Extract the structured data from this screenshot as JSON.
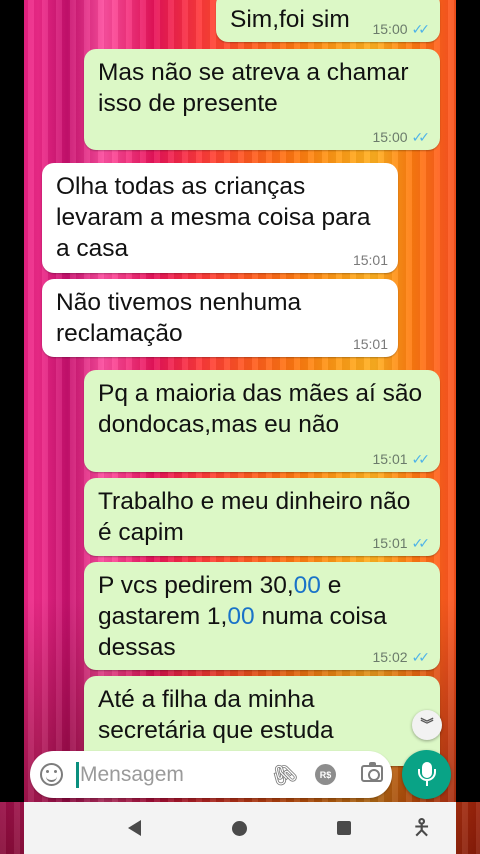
{
  "colors": {
    "outgoing_bubble": "#dcf8c6",
    "incoming_bubble": "#ffffff",
    "read_ticks": "#4fb3e8",
    "mic_button": "#09a386"
  },
  "messages": [
    {
      "direction": "out",
      "text": "Sim,foi sim",
      "time": "15:00",
      "read": true
    },
    {
      "direction": "out",
      "text": "Mas não se atreva a chamar isso de presente",
      "time": "15:00",
      "read": true
    },
    {
      "direction": "in",
      "text": "Olha todas as crianças levaram a mesma coisa para a casa",
      "time": "15:01"
    },
    {
      "direction": "in",
      "text": "Não tivemos nenhuma reclamação",
      "time": "15:01"
    },
    {
      "direction": "out",
      "text": "Pq a maioria das mães aí são dondocas,mas eu não",
      "time": "15:01",
      "read": true
    },
    {
      "direction": "out",
      "text": "Trabalho e meu dinheiro não é capim",
      "time": "15:01",
      "read": true
    },
    {
      "direction": "out",
      "text_parts": [
        "P vcs pedirem 30,",
        "00",
        " e gastarem 1,",
        "00",
        " numa coisa dessas"
      ],
      "time": "15:02",
      "read": true
    },
    {
      "direction": "out",
      "text": "Até a filha da minha secretária que estuda",
      "time": ""
    }
  ],
  "composer": {
    "placeholder": "Mensagem",
    "emoji_icon": "emoji-icon",
    "attach_icon": "paperclip-icon",
    "payment_icon": "rs-payment-icon",
    "payment_label": "R$",
    "camera_icon": "camera-icon",
    "mic_icon": "microphone-icon"
  },
  "scroll_down_icon": "double-chevron-down-icon",
  "navbar": {
    "back_icon": "back-triangle-icon",
    "home_icon": "home-circle-icon",
    "recents_icon": "recents-square-icon",
    "accessibility_icon": "accessibility-person-icon"
  }
}
